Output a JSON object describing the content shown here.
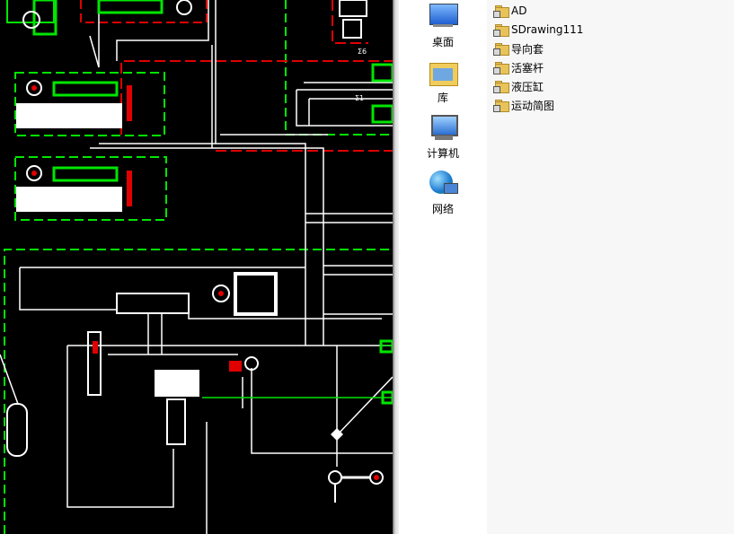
{
  "desktop_shortcuts": [
    {
      "label": "桌面",
      "icon": "desktop-icon"
    },
    {
      "label": "库",
      "icon": "library-icon"
    },
    {
      "label": "计算机",
      "icon": "computer-icon"
    },
    {
      "label": "网络",
      "icon": "network-icon"
    }
  ],
  "files": [
    {
      "name": "AD",
      "icon": "folder-icon"
    },
    {
      "name": "SDrawing111",
      "icon": "folder-icon"
    },
    {
      "name": "导向套",
      "icon": "folder-icon"
    },
    {
      "name": "活塞杆",
      "icon": "folder-icon"
    },
    {
      "name": "液压缸",
      "icon": "folder-icon"
    },
    {
      "name": "运动简图",
      "icon": "folder-icon"
    }
  ],
  "cad": {
    "labels": {
      "label_1": "Σ6",
      "label_2": "Σ1"
    },
    "colors": {
      "background": "#000000",
      "line": "#ffffff",
      "green": "#00e600",
      "red": "#e00000"
    }
  }
}
